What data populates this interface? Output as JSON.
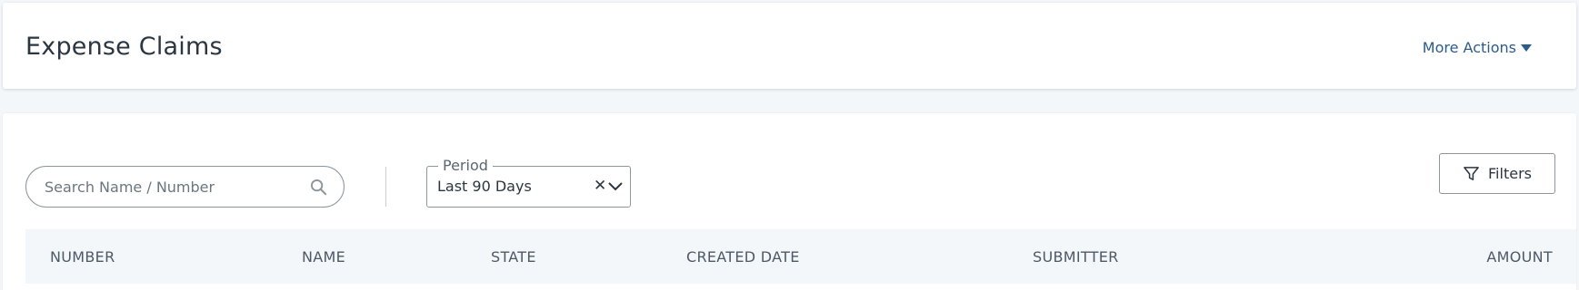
{
  "header": {
    "title": "Expense Claims",
    "more_actions_label": "More Actions"
  },
  "toolbar": {
    "search_placeholder": "Search Name / Number",
    "period": {
      "label": "Period",
      "value": "Last 90 Days"
    },
    "filters_label": "Filters"
  },
  "table": {
    "columns": [
      "NUMBER",
      "NAME",
      "STATE",
      "CREATED DATE",
      "SUBMITTER",
      "AMOUNT"
    ]
  },
  "colors": {
    "accent": "#2b5c8c",
    "background": "#f4f7fa",
    "border": "#8d959c"
  }
}
